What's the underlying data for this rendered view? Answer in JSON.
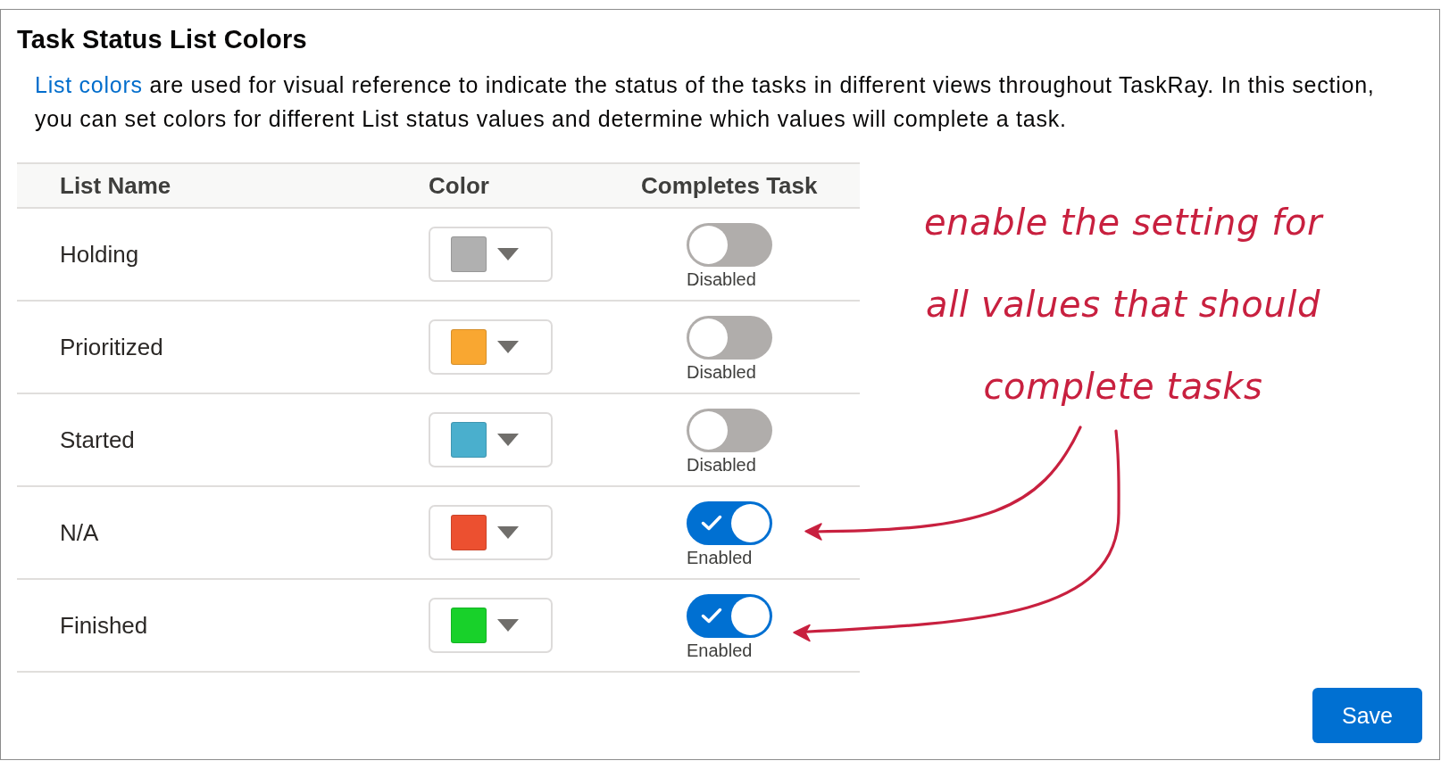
{
  "section": {
    "title": "Task Status List Colors",
    "description": {
      "link": "List colors",
      "text": "are used for visual reference to indicate the status of the tasks in different views throughout TaskRay. In this section, you can set colors for different List status values and determine which values will complete a task."
    }
  },
  "table": {
    "columns": [
      "List Name",
      "Color",
      "Completes Task"
    ],
    "rows": [
      {
        "name": "Holding",
        "color": "#b0b0b0",
        "completes_task": false,
        "status_label": "Disabled"
      },
      {
        "name": "Prioritized",
        "color": "#f9a731",
        "completes_task": false,
        "status_label": "Disabled"
      },
      {
        "name": "Started",
        "color": "#4aafcd",
        "completes_task": false,
        "status_label": "Disabled"
      },
      {
        "name": "N/A",
        "color": "#ec5030",
        "completes_task": true,
        "status_label": "Enabled"
      },
      {
        "name": "Finished",
        "color": "#18d12a",
        "completes_task": true,
        "status_label": "Enabled"
      }
    ]
  },
  "annotation": {
    "lines": [
      "enable the setting for",
      "all values that should",
      "complete tasks"
    ]
  },
  "save_button": {
    "label": "Save"
  }
}
